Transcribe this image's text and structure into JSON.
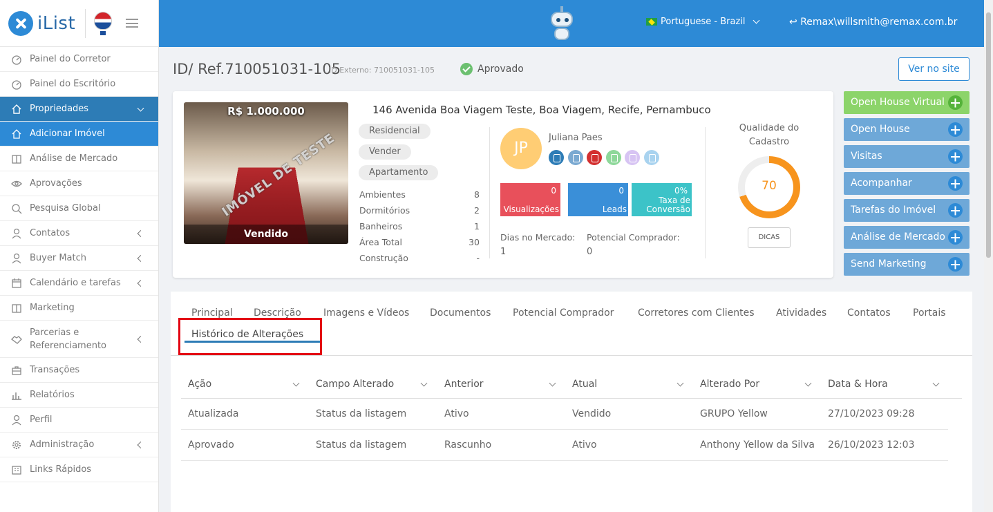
{
  "app": {
    "logo_text": "iList"
  },
  "sidebar": {
    "items": [
      {
        "label": "Painel do Corretor"
      },
      {
        "label": "Painel do Escritório"
      },
      {
        "label": "Propriedades"
      },
      {
        "label": "Adicionar Imóvel"
      },
      {
        "label": "Análise de Mercado"
      },
      {
        "label": "Aprovações"
      },
      {
        "label": "Pesquisa Global"
      },
      {
        "label": "Contatos"
      },
      {
        "label": "Buyer Match"
      },
      {
        "label": "Calendário e tarefas"
      },
      {
        "label": "Marketing"
      },
      {
        "label": "Parcerias e Referenciamento"
      },
      {
        "label": "Transações"
      },
      {
        "label": "Relatórios"
      },
      {
        "label": "Perfil"
      },
      {
        "label": "Administração"
      },
      {
        "label": "Links Rápidos"
      }
    ]
  },
  "topbar": {
    "language": "Portuguese - Brazil",
    "user": "Remax\\willsmith@remax.com.br"
  },
  "header": {
    "id": "ID/ Ref.710051031-105",
    "external_id": "ID Externo: 710051031-105",
    "status": "Aprovado",
    "view_site": "Ver no site"
  },
  "property": {
    "price": "R$ 1.000.000",
    "watermark": "IMÓVEL DE TESTE",
    "sold_label": "Vendido",
    "address": "146 Avenida Boa Viagem Teste, Boa Viagem, Recife, Pernambuco",
    "tags": [
      "Residencial",
      "Vender",
      "Apartamento"
    ],
    "specs": [
      {
        "label": "Ambientes",
        "value": "8"
      },
      {
        "label": "Dormitórios",
        "value": "2"
      },
      {
        "label": "Banheiros",
        "value": "1"
      },
      {
        "label": "Área Total",
        "value": "30"
      },
      {
        "label": "Construção",
        "value": "-"
      }
    ]
  },
  "agent": {
    "initials": "JP",
    "name": "Juliana Paes",
    "metrics": [
      {
        "value": "0",
        "label": "Visualizações",
        "color": "#e8505b"
      },
      {
        "value": "0",
        "label": "Leads",
        "color": "#3a8fd8"
      },
      {
        "value": "0%",
        "label": "Taxa de Conversão",
        "color": "#3cc3c8"
      }
    ],
    "days_label": "Dias no Mercado:",
    "days_value": "1",
    "buyer_label": "Potencial Comprador:",
    "buyer_value": "0"
  },
  "quality": {
    "title": "Qualidade do Cadastro",
    "score": "70",
    "percent": 70,
    "tips": "DICAS"
  },
  "actions": [
    "Open House Virtual",
    "Open House",
    "Visitas",
    "Acompanhar",
    "Tarefas do Imóvel",
    "Análise de Mercado",
    "Send Marketing"
  ],
  "tabs": [
    "Principal",
    "Descrição",
    "Imagens e Vídeos",
    "Documentos",
    "Potencial Comprador",
    "Corretores com Clientes",
    "Atividades",
    "Contatos",
    "Portais",
    "Histórico de Alterações"
  ],
  "history_table": {
    "headers": [
      "Ação",
      "Campo Alterado",
      "Anterior",
      "Atual",
      "Alterado Por",
      "Data & Hora"
    ],
    "rows": [
      [
        "Atualizada",
        "Status da listagem",
        "Ativo",
        "Vendido",
        "GRUPO Yellow",
        "27/10/2023 09:28"
      ],
      [
        "Aprovado",
        "Status da listagem",
        "Rascunho",
        "Ativo",
        "Anthony Yellow da Silva",
        "26/10/2023 12:03"
      ]
    ]
  },
  "colors": {
    "primary": "#2d8ad6",
    "sidebar_active": "#2d7cb6",
    "highlight": "#e30613",
    "quality": "#f7941d"
  }
}
